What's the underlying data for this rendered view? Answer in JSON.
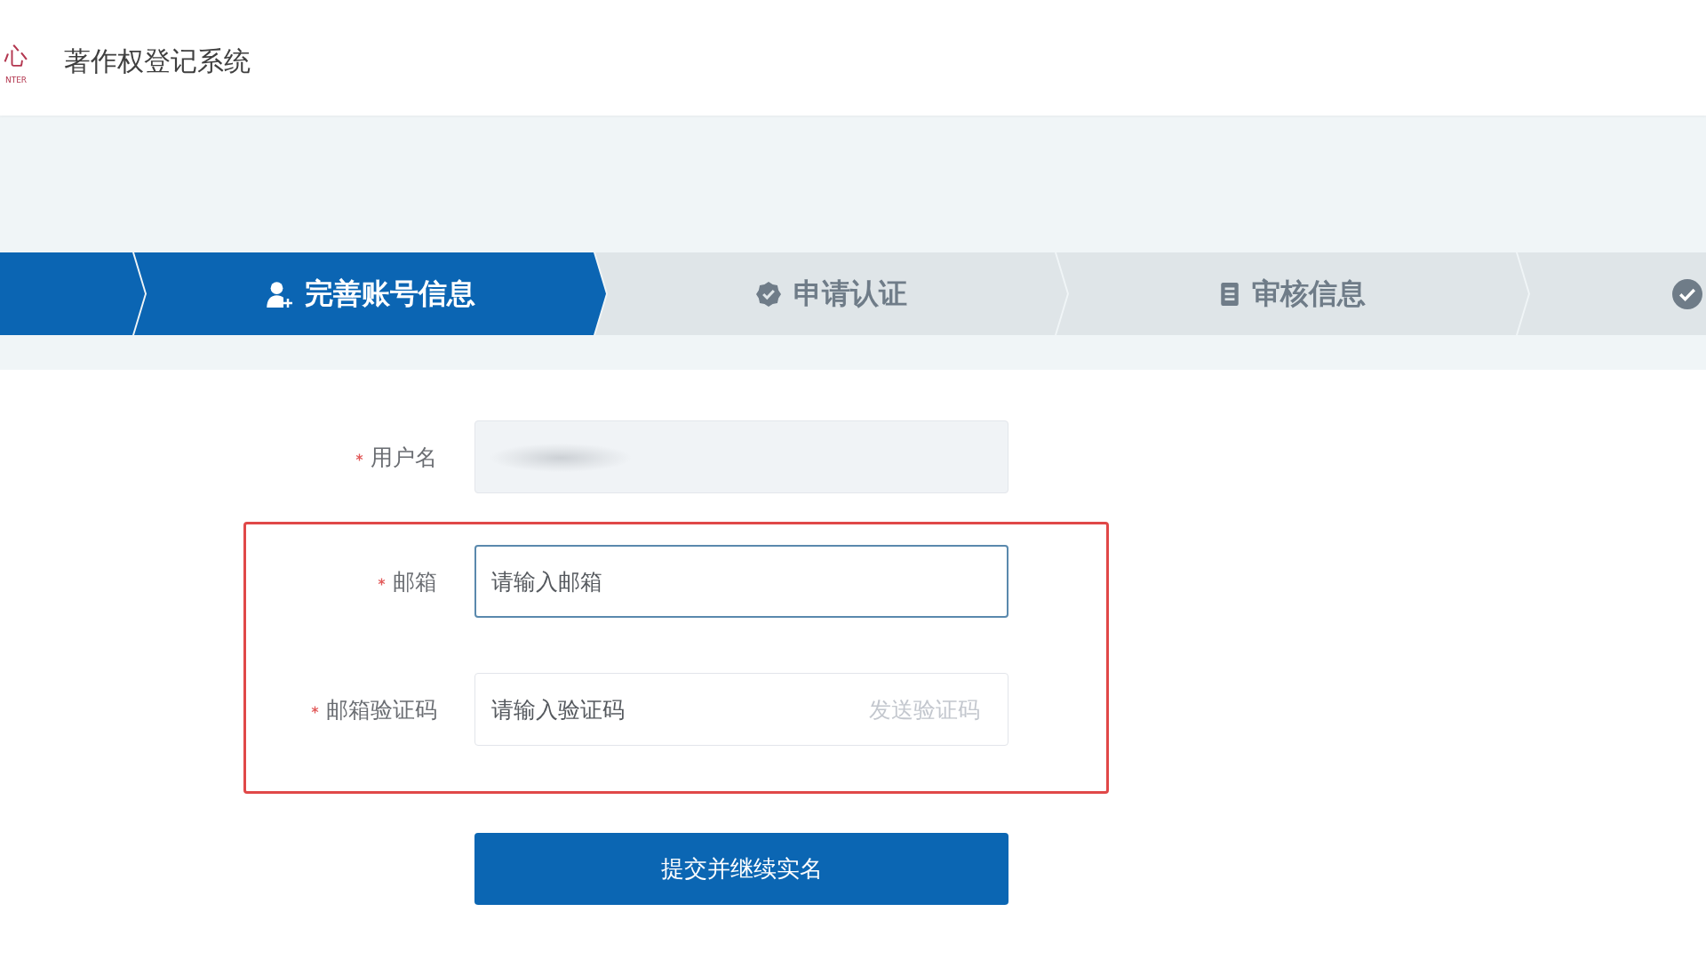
{
  "header": {
    "logo_glyph": "心",
    "logo_caption": "NTER",
    "title": "著作权登记系统"
  },
  "steps": [
    {
      "active": true
    },
    {
      "label": "完善账号信息",
      "active": true
    },
    {
      "label": "申请认证",
      "active": false
    },
    {
      "label": "审核信息",
      "active": false
    },
    {
      "active": false
    }
  ],
  "form": {
    "fields": [
      {
        "label": "用户名",
        "required": true,
        "disabled": true,
        "redacted": true,
        "focused": false,
        "highlighted": false
      },
      {
        "label": "邮箱",
        "required": true,
        "placeholder": "请输入邮箱",
        "disabled": false,
        "redacted": false,
        "focused": true,
        "highlighted": true
      },
      {
        "label": "邮箱验证码",
        "required": true,
        "placeholder": "请输入验证码",
        "action": "发送验证码",
        "disabled": false,
        "redacted": false,
        "focused": false,
        "highlighted": true
      }
    ],
    "submit_button": "提交并继续实名"
  }
}
